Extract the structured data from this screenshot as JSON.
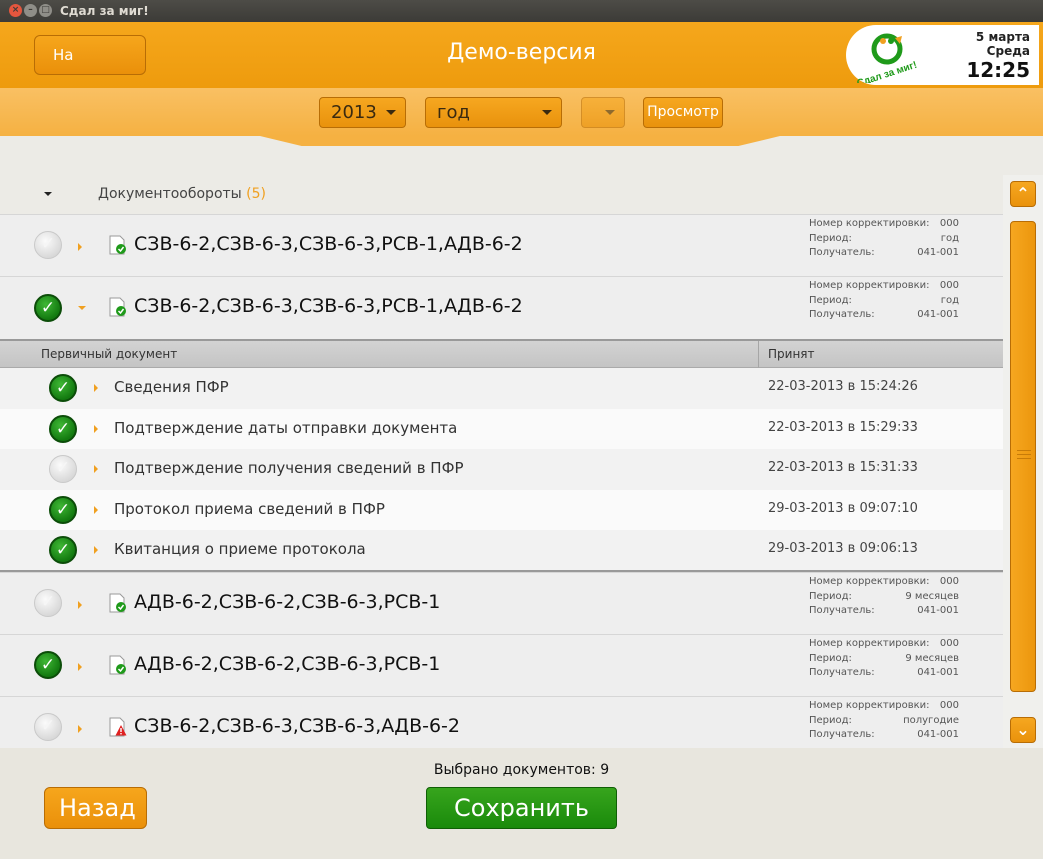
{
  "window": {
    "title": "Сдал за миг!",
    "controls": [
      "×",
      "–",
      "□"
    ]
  },
  "header": {
    "home_label": "На главную",
    "page_title": "Демо-версия",
    "logo_text": "Сдал за миг!",
    "date": "5 марта",
    "weekday": "Среда",
    "time": "12:25"
  },
  "filters": {
    "year": "2013",
    "period": "год",
    "extra": "",
    "view_label": "Просмотр"
  },
  "group": {
    "label": "Документообороты",
    "count": "(5)"
  },
  "meta_labels": {
    "correction": "Номер корректировки:",
    "period": "Период:",
    "recipient": "Получатель:"
  },
  "documents": [
    {
      "title": "СЗВ-6-2,СЗВ-6-3,СЗВ-6-3,РСВ-1,АДВ-6-2",
      "checked": false,
      "status_icon": "doc-ok-icon",
      "correction": "000",
      "period": "год",
      "recipient": "041-001"
    },
    {
      "title": "СЗВ-6-2,СЗВ-6-3,СЗВ-6-3,РСВ-1,АДВ-6-2",
      "checked": true,
      "status_icon": "doc-ok-icon",
      "correction": "000",
      "period": "год",
      "recipient": "041-001"
    },
    {
      "title": "АДВ-6-2,СЗВ-6-2,СЗВ-6-3,РСВ-1",
      "checked": false,
      "status_icon": "doc-ok-icon",
      "correction": "000",
      "period": "9 месяцев",
      "recipient": "041-001"
    },
    {
      "title": "АДВ-6-2,СЗВ-6-2,СЗВ-6-3,РСВ-1",
      "checked": true,
      "status_icon": "doc-ok-icon",
      "correction": "000",
      "period": "9 месяцев",
      "recipient": "041-001"
    },
    {
      "title": "СЗВ-6-2,СЗВ-6-3,СЗВ-6-3,АДВ-6-2",
      "checked": false,
      "status_icon": "doc-warning-icon",
      "correction": "000",
      "period": "полугодие",
      "recipient": "041-001"
    }
  ],
  "subtable": {
    "col1": "Первичный документ",
    "col2": "Принят",
    "rows": [
      {
        "title": "Сведения ПФР",
        "date": "22-03-2013 в 15:24:26",
        "checked": true
      },
      {
        "title": "Подтверждение даты отправки документа",
        "date": "22-03-2013 в 15:29:33",
        "checked": true
      },
      {
        "title": "Подтверждение получения сведений в ПФР",
        "date": "22-03-2013 в 15:31:33",
        "checked": false
      },
      {
        "title": "Протокол приема сведений в ПФР",
        "date": "29-03-2013 в 09:07:10",
        "checked": true
      },
      {
        "title": "Квитанция о приеме протокола",
        "date": "29-03-2013 в 09:06:13",
        "checked": true
      }
    ]
  },
  "footer": {
    "selected_text": "Выбрано документов: 9",
    "back_label": "Назад",
    "save_label": "Сохранить"
  },
  "colors": {
    "accent": "#f5a71c",
    "success": "#1a8a0b",
    "warning": "#e02020"
  }
}
